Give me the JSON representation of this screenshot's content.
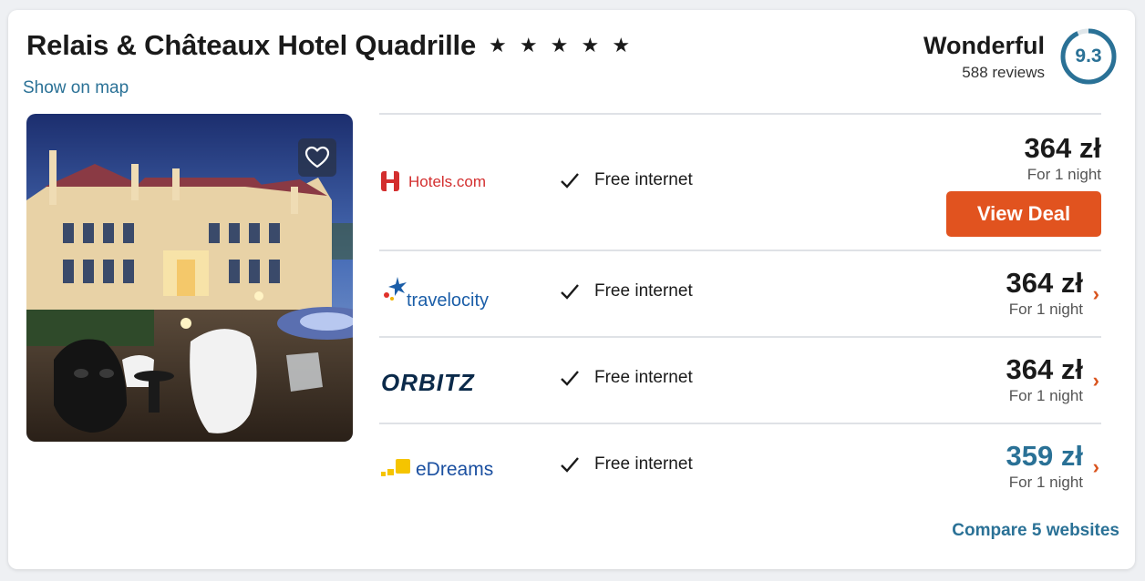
{
  "hotel": {
    "name": "Relais & Châteaux Hotel Quadrille",
    "stars_text": "★ ★ ★ ★ ★",
    "star_count": 5,
    "show_on_map": "Show on map"
  },
  "rating": {
    "word": "Wonderful",
    "reviews": "588 reviews",
    "score": "9.3",
    "score_fraction": 0.93
  },
  "photo": {
    "favorite_icon": "heart-icon"
  },
  "deals": [
    {
      "provider": "Hotels.com",
      "amenity": "Free internet",
      "price": "364 zł",
      "per_night": "For 1 night",
      "button": "View Deal"
    },
    {
      "provider": "travelocity",
      "amenity": "Free internet",
      "price": "364 zł",
      "per_night": "For 1 night"
    },
    {
      "provider": "ORBITZ",
      "amenity": "Free internet",
      "price": "364 zł",
      "per_night": "For 1 night"
    },
    {
      "provider": "eDreams",
      "amenity": "Free internet",
      "price": "359 zł",
      "per_night": "For 1 night"
    }
  ],
  "compare_link": "Compare 5 websites",
  "colors": {
    "accent_blue": "#2a7196",
    "deal_orange": "#e1531f",
    "hotels_red": "#d32f2f",
    "orbitz_navy": "#0b2a4a",
    "edreams_blue": "#1a4fa0",
    "edreams_yellow": "#f5c400",
    "travelocity_blue": "#1b5ea8"
  }
}
